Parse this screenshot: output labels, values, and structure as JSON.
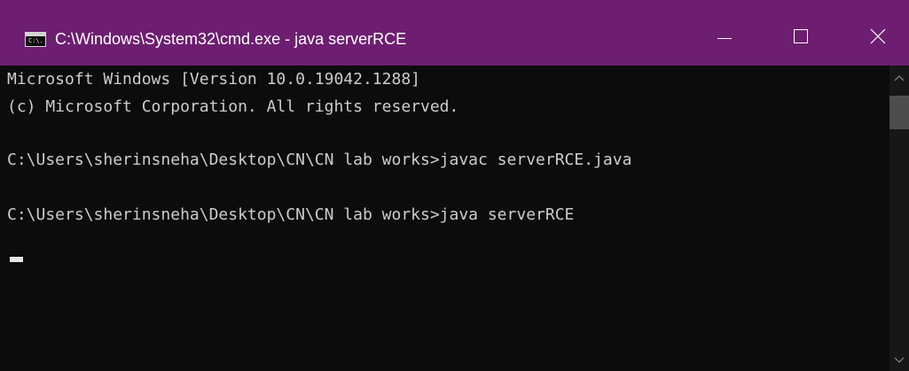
{
  "window": {
    "title": "C:\\Windows\\System32\\cmd.exe - java  serverRCE",
    "app_icon": "cmd-icon",
    "app_icon_text": "C:\\.",
    "controls": {
      "minimize": "minimize-icon",
      "maximize": "maximize-icon",
      "close": "close-icon"
    },
    "titlebar_color": "#6d1e70"
  },
  "console": {
    "lines": [
      "Microsoft Windows [Version 10.0.19042.1288]",
      "(c) Microsoft Corporation. All rights reserved.",
      "C:\\Users\\sherinsneha\\Desktop\\CN\\CN lab works>javac serverRCE.java",
      "C:\\Users\\sherinsneha\\Desktop\\CN\\CN lab works>java serverRCE"
    ],
    "background": "#0c0c0c",
    "text_color": "#cccccc"
  },
  "scrollbar": {
    "up_icon": "chevron-up-icon",
    "down_icon": "chevron-down-icon"
  }
}
